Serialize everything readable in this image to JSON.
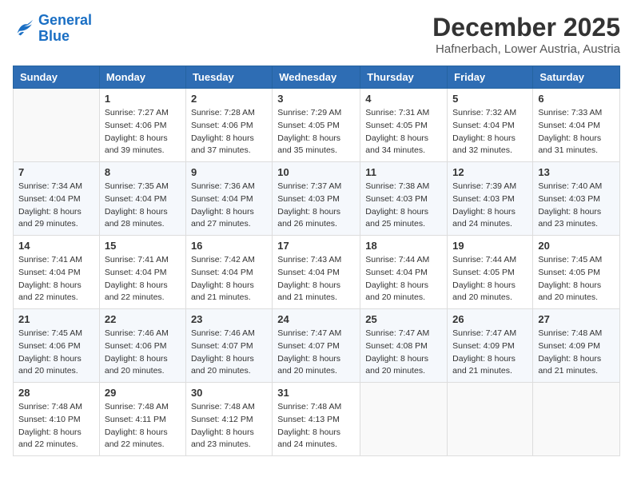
{
  "logo": {
    "line1": "General",
    "line2": "Blue"
  },
  "title": "December 2025",
  "location": "Hafnerbach, Lower Austria, Austria",
  "weekdays": [
    "Sunday",
    "Monday",
    "Tuesday",
    "Wednesday",
    "Thursday",
    "Friday",
    "Saturday"
  ],
  "weeks": [
    [
      {
        "day": "",
        "info": ""
      },
      {
        "day": "1",
        "info": "Sunrise: 7:27 AM\nSunset: 4:06 PM\nDaylight: 8 hours\nand 39 minutes."
      },
      {
        "day": "2",
        "info": "Sunrise: 7:28 AM\nSunset: 4:06 PM\nDaylight: 8 hours\nand 37 minutes."
      },
      {
        "day": "3",
        "info": "Sunrise: 7:29 AM\nSunset: 4:05 PM\nDaylight: 8 hours\nand 35 minutes."
      },
      {
        "day": "4",
        "info": "Sunrise: 7:31 AM\nSunset: 4:05 PM\nDaylight: 8 hours\nand 34 minutes."
      },
      {
        "day": "5",
        "info": "Sunrise: 7:32 AM\nSunset: 4:04 PM\nDaylight: 8 hours\nand 32 minutes."
      },
      {
        "day": "6",
        "info": "Sunrise: 7:33 AM\nSunset: 4:04 PM\nDaylight: 8 hours\nand 31 minutes."
      }
    ],
    [
      {
        "day": "7",
        "info": "Sunrise: 7:34 AM\nSunset: 4:04 PM\nDaylight: 8 hours\nand 29 minutes."
      },
      {
        "day": "8",
        "info": "Sunrise: 7:35 AM\nSunset: 4:04 PM\nDaylight: 8 hours\nand 28 minutes."
      },
      {
        "day": "9",
        "info": "Sunrise: 7:36 AM\nSunset: 4:04 PM\nDaylight: 8 hours\nand 27 minutes."
      },
      {
        "day": "10",
        "info": "Sunrise: 7:37 AM\nSunset: 4:03 PM\nDaylight: 8 hours\nand 26 minutes."
      },
      {
        "day": "11",
        "info": "Sunrise: 7:38 AM\nSunset: 4:03 PM\nDaylight: 8 hours\nand 25 minutes."
      },
      {
        "day": "12",
        "info": "Sunrise: 7:39 AM\nSunset: 4:03 PM\nDaylight: 8 hours\nand 24 minutes."
      },
      {
        "day": "13",
        "info": "Sunrise: 7:40 AM\nSunset: 4:03 PM\nDaylight: 8 hours\nand 23 minutes."
      }
    ],
    [
      {
        "day": "14",
        "info": "Sunrise: 7:41 AM\nSunset: 4:04 PM\nDaylight: 8 hours\nand 22 minutes."
      },
      {
        "day": "15",
        "info": "Sunrise: 7:41 AM\nSunset: 4:04 PM\nDaylight: 8 hours\nand 22 minutes."
      },
      {
        "day": "16",
        "info": "Sunrise: 7:42 AM\nSunset: 4:04 PM\nDaylight: 8 hours\nand 21 minutes."
      },
      {
        "day": "17",
        "info": "Sunrise: 7:43 AM\nSunset: 4:04 PM\nDaylight: 8 hours\nand 21 minutes."
      },
      {
        "day": "18",
        "info": "Sunrise: 7:44 AM\nSunset: 4:04 PM\nDaylight: 8 hours\nand 20 minutes."
      },
      {
        "day": "19",
        "info": "Sunrise: 7:44 AM\nSunset: 4:05 PM\nDaylight: 8 hours\nand 20 minutes."
      },
      {
        "day": "20",
        "info": "Sunrise: 7:45 AM\nSunset: 4:05 PM\nDaylight: 8 hours\nand 20 minutes."
      }
    ],
    [
      {
        "day": "21",
        "info": "Sunrise: 7:45 AM\nSunset: 4:06 PM\nDaylight: 8 hours\nand 20 minutes."
      },
      {
        "day": "22",
        "info": "Sunrise: 7:46 AM\nSunset: 4:06 PM\nDaylight: 8 hours\nand 20 minutes."
      },
      {
        "day": "23",
        "info": "Sunrise: 7:46 AM\nSunset: 4:07 PM\nDaylight: 8 hours\nand 20 minutes."
      },
      {
        "day": "24",
        "info": "Sunrise: 7:47 AM\nSunset: 4:07 PM\nDaylight: 8 hours\nand 20 minutes."
      },
      {
        "day": "25",
        "info": "Sunrise: 7:47 AM\nSunset: 4:08 PM\nDaylight: 8 hours\nand 20 minutes."
      },
      {
        "day": "26",
        "info": "Sunrise: 7:47 AM\nSunset: 4:09 PM\nDaylight: 8 hours\nand 21 minutes."
      },
      {
        "day": "27",
        "info": "Sunrise: 7:48 AM\nSunset: 4:09 PM\nDaylight: 8 hours\nand 21 minutes."
      }
    ],
    [
      {
        "day": "28",
        "info": "Sunrise: 7:48 AM\nSunset: 4:10 PM\nDaylight: 8 hours\nand 22 minutes."
      },
      {
        "day": "29",
        "info": "Sunrise: 7:48 AM\nSunset: 4:11 PM\nDaylight: 8 hours\nand 22 minutes."
      },
      {
        "day": "30",
        "info": "Sunrise: 7:48 AM\nSunset: 4:12 PM\nDaylight: 8 hours\nand 23 minutes."
      },
      {
        "day": "31",
        "info": "Sunrise: 7:48 AM\nSunset: 4:13 PM\nDaylight: 8 hours\nand 24 minutes."
      },
      {
        "day": "",
        "info": ""
      },
      {
        "day": "",
        "info": ""
      },
      {
        "day": "",
        "info": ""
      }
    ]
  ]
}
